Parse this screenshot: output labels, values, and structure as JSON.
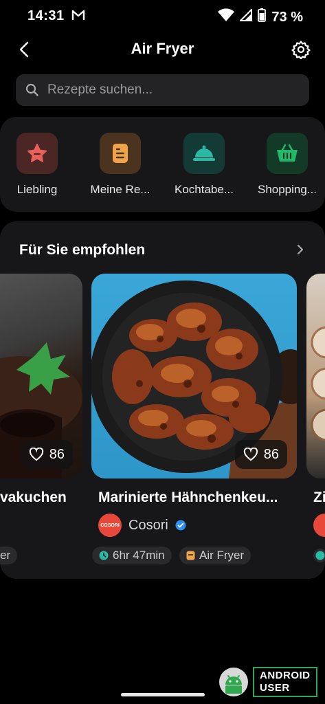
{
  "status_bar": {
    "time": "14:31",
    "battery": "73 %"
  },
  "header": {
    "title": "Air Fryer"
  },
  "search": {
    "placeholder": "Rezepte suchen..."
  },
  "quick_actions": [
    {
      "label": "Liebling",
      "icon": "favorite-star-icon",
      "color": "#e8605a"
    },
    {
      "label": "Meine Re...",
      "icon": "my-recipes-icon",
      "color": "#f0a44a"
    },
    {
      "label": "Kochtabe...",
      "icon": "cloche-icon",
      "color": "#2bb8a4"
    },
    {
      "label": "Shopping...",
      "icon": "basket-icon",
      "color": "#22b86a"
    }
  ],
  "recommended": {
    "title": "Für Sie empfohlen",
    "cards": [
      {
        "title": "vakuchen",
        "likes": "86",
        "chip": "er"
      },
      {
        "title": "Marinierte Hähnchenkeu...",
        "likes": "86",
        "author": "Cosori",
        "avatar_text": "COSORI",
        "time": "6hr 47min",
        "device": "Air Fryer"
      },
      {
        "title": "Zi"
      }
    ]
  },
  "watermark": {
    "line1": "ANDROID",
    "line2": "USER"
  }
}
